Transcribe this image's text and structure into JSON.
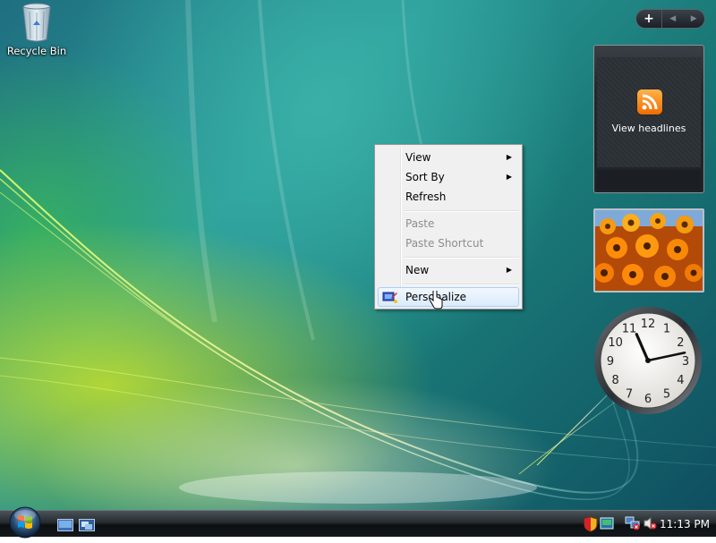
{
  "desktop": {
    "recycle_bin_label": "Recycle Bin"
  },
  "sidebar": {
    "add_glyph": "+",
    "prev_glyph": "◀",
    "next_glyph": "▶",
    "feed_gadget": {
      "icon": "rss-icon",
      "text": "View headlines"
    },
    "clock": {
      "hour": 11,
      "minute": 13
    }
  },
  "context_menu": {
    "items": [
      {
        "label": "View",
        "submenu": true,
        "disabled": false
      },
      {
        "label": "Sort By",
        "submenu": true,
        "disabled": false
      },
      {
        "label": "Refresh",
        "submenu": false,
        "disabled": false
      },
      {
        "label": "Paste",
        "submenu": false,
        "disabled": true
      },
      {
        "label": "Paste Shortcut",
        "submenu": false,
        "disabled": true
      },
      {
        "label": "New",
        "submenu": true,
        "disabled": false
      },
      {
        "label": "Personalize",
        "submenu": false,
        "disabled": false,
        "highlighted": true,
        "icon": "personalize-icon"
      }
    ]
  },
  "taskbar": {
    "quick_launch": [
      "show-desktop-icon",
      "switch-windows-icon"
    ],
    "tray_icons": [
      "security-shield-icon",
      "network-icon",
      "volume-muted-icon"
    ],
    "time": "11:13 PM"
  },
  "colors": {
    "menu_bg": "#f0f0f0",
    "highlight_border": "#aecff7",
    "rss_orange": "#f06c00"
  }
}
